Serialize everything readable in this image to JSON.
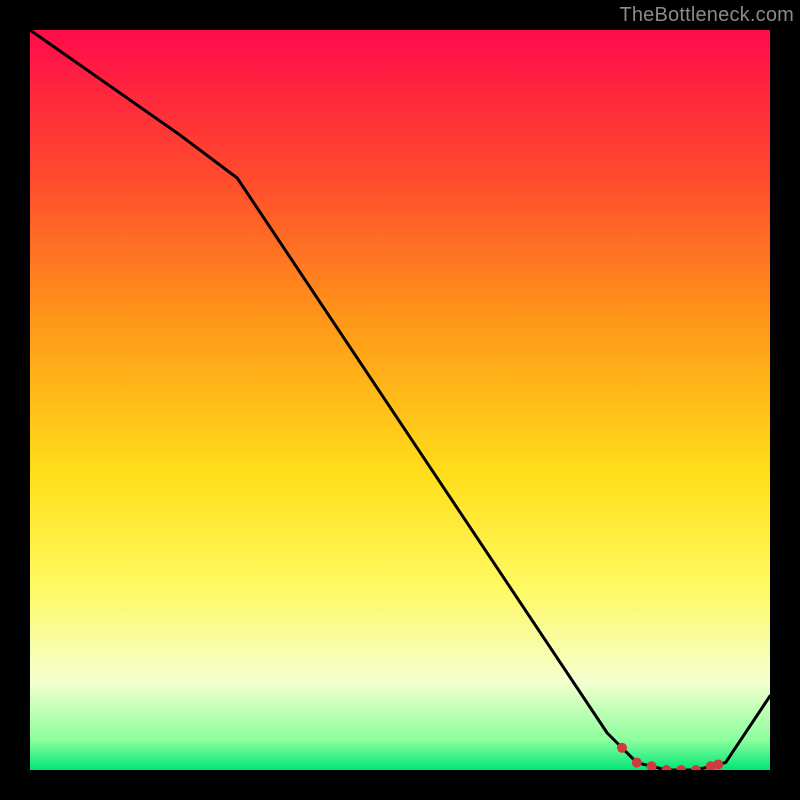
{
  "watermark": "TheBottleneck.com",
  "chart_data": {
    "type": "line",
    "title": "",
    "xlabel": "",
    "ylabel": "",
    "xlim": [
      0,
      100
    ],
    "ylim": [
      0,
      100
    ],
    "x": [
      0,
      10,
      20,
      28,
      40,
      50,
      60,
      70,
      78,
      82,
      86,
      90,
      94,
      100
    ],
    "values": [
      100,
      93,
      86,
      80,
      62,
      47,
      32,
      17,
      5,
      1,
      0,
      0,
      1,
      10
    ],
    "gradient_stops": [
      {
        "offset": 0.0,
        "color": "#ff0b4a"
      },
      {
        "offset": 0.2,
        "color": "#ff4b2d"
      },
      {
        "offset": 0.4,
        "color": "#ff9a18"
      },
      {
        "offset": 0.6,
        "color": "#ffde1a"
      },
      {
        "offset": 0.75,
        "color": "#fff960"
      },
      {
        "offset": 0.88,
        "color": "#f5ffd0"
      },
      {
        "offset": 0.96,
        "color": "#8aff9e"
      },
      {
        "offset": 1.0,
        "color": "#00e676"
      }
    ],
    "highlight_points_x": [
      80,
      82,
      84,
      86,
      88,
      90,
      92,
      93
    ],
    "highlight_points_color": "#cf3a3a"
  }
}
